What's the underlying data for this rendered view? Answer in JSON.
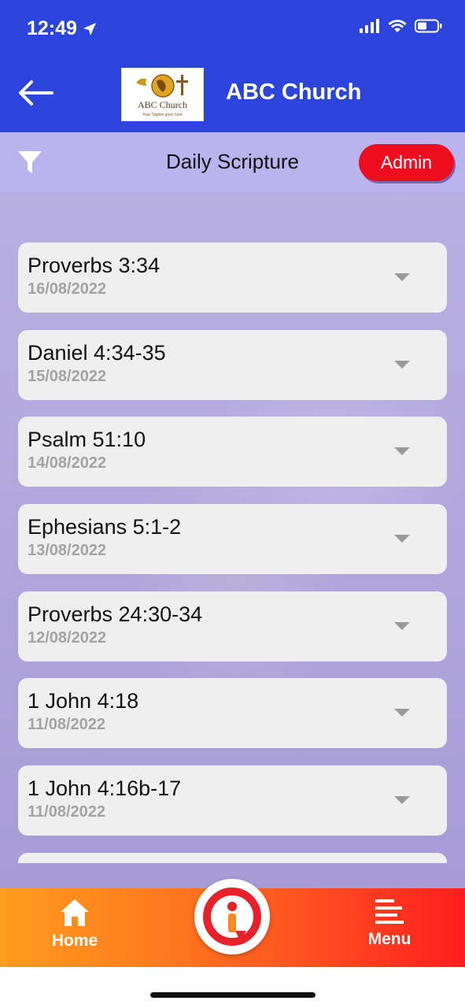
{
  "status_bar": {
    "time": "12:49"
  },
  "header": {
    "logo_text": "ABC Church",
    "logo_tagline": "Your Tagline goes here",
    "title": "ABC Church"
  },
  "subbar": {
    "title": "Daily Scripture",
    "admin_label": "Admin"
  },
  "scriptures": [
    {
      "reference": "Proverbs 3:34",
      "date": "16/08/2022"
    },
    {
      "reference": "Daniel 4:34-35",
      "date": "15/08/2022"
    },
    {
      "reference": "Psalm 51:10",
      "date": "14/08/2022"
    },
    {
      "reference": "Ephesians 5:1-2",
      "date": "13/08/2022"
    },
    {
      "reference": "Proverbs 24:30-34",
      "date": "12/08/2022"
    },
    {
      "reference": "1 John 4:18",
      "date": "11/08/2022"
    },
    {
      "reference": "1 John 4:16b-17",
      "date": "11/08/2022"
    },
    {
      "reference": "",
      "date": ""
    }
  ],
  "bottom_nav": {
    "home_label": "Home",
    "menu_label": "Menu"
  },
  "colors": {
    "header_blue": "#2d44dc",
    "admin_red": "#ee0d1e",
    "nav_orange": "#ff9c1e",
    "nav_red": "#ff1d1d"
  },
  "icons": {
    "back": "back-arrow-icon",
    "filter": "filter-icon",
    "caret": "chevron-down-icon",
    "home": "home-icon",
    "menu": "menu-lines-icon"
  }
}
